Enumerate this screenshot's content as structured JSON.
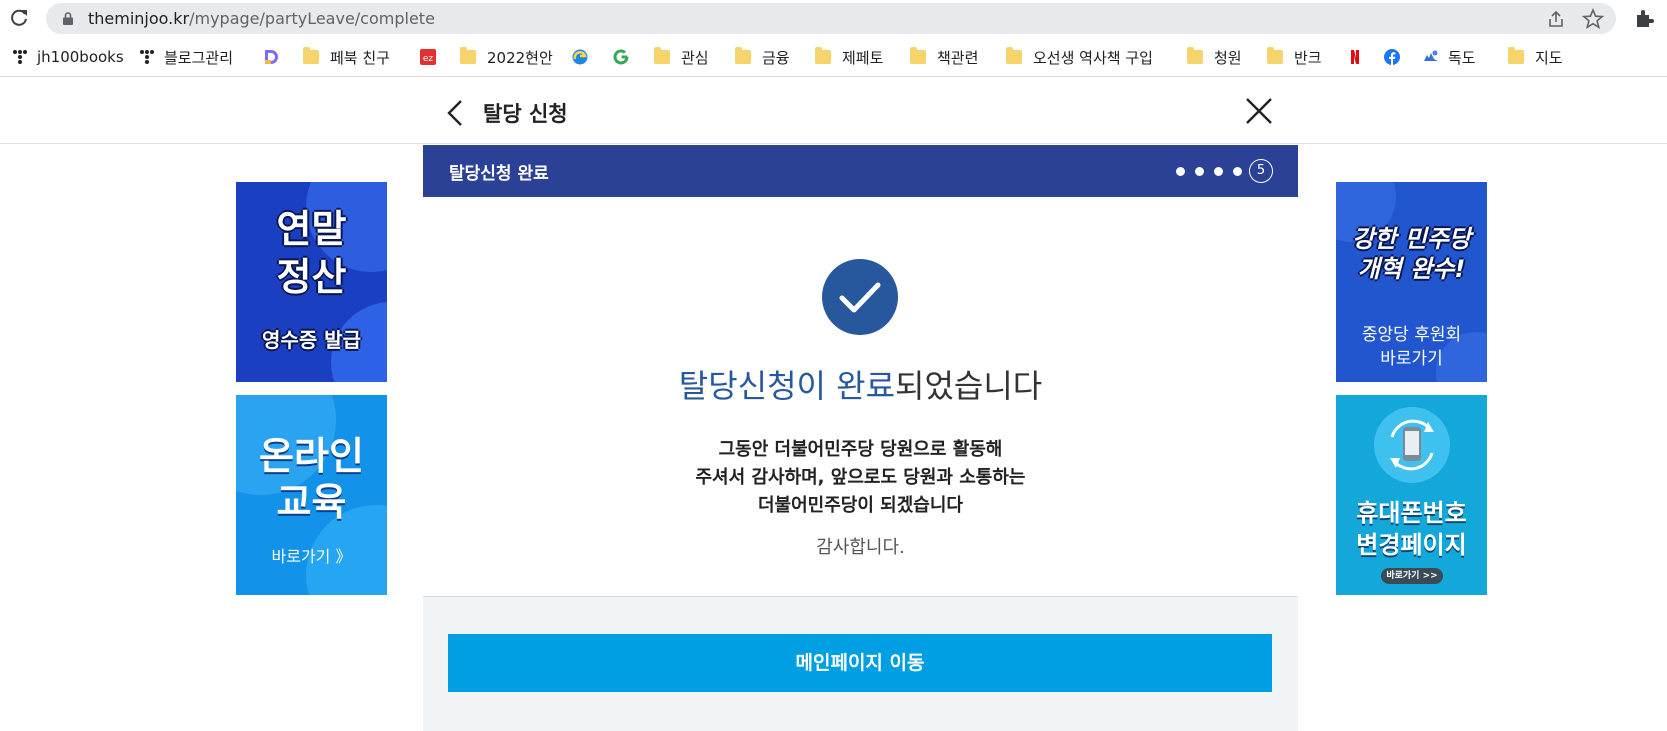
{
  "browser": {
    "url_host": "theminjoo.kr",
    "url_path": "/mypage/partyLeave/complete",
    "bookmarks": [
      {
        "label": "jh100books",
        "icon": "tistory-icon"
      },
      {
        "label": "블로그관리",
        "icon": "tistory-icon"
      },
      {
        "label": "",
        "icon": "d-logo-icon"
      },
      {
        "label": "페북 친구",
        "icon": "folder-icon"
      },
      {
        "label": "",
        "icon": "ez-icon"
      },
      {
        "label": "2022현안",
        "icon": "folder-icon"
      },
      {
        "label": "",
        "icon": "edge-icon"
      },
      {
        "label": "",
        "icon": "google-g-icon"
      },
      {
        "label": "관심",
        "icon": "folder-icon"
      },
      {
        "label": "금융",
        "icon": "folder-icon"
      },
      {
        "label": "제페토",
        "icon": "folder-icon"
      },
      {
        "label": "책관련",
        "icon": "folder-icon"
      },
      {
        "label": "오선생 역사책 구입",
        "icon": "folder-icon"
      },
      {
        "label": "청원",
        "icon": "folder-icon"
      },
      {
        "label": "반크",
        "icon": "folder-icon"
      },
      {
        "label": "",
        "icon": "netflix-icon"
      },
      {
        "label": "",
        "icon": "facebook-icon"
      },
      {
        "label": "독도",
        "icon": "dokdo-icon"
      },
      {
        "label": "지도",
        "icon": "folder-icon"
      }
    ]
  },
  "header": {
    "title": "탈당 신청"
  },
  "steps": {
    "title": "탈당신청 완료",
    "current_step": "5"
  },
  "result": {
    "headline_highlight": "탈당신청이 완료",
    "headline_rest": "되었습니다",
    "message_lines": [
      "그동안 더불어민주당 당원으로 활동해",
      "주셔서 감사하며, 앞으로도 당원과 소통하는",
      "더불어민주당이 되겠습니다"
    ],
    "thanks": "감사합니다.",
    "button_label": "메인페이지 이동"
  },
  "banners": {
    "left_top": {
      "line1": "연말",
      "line2": "정산",
      "line3": "영수증 발급"
    },
    "left_bottom": {
      "line1": "온라인",
      "line2": "교육",
      "line3": "바로가기 》"
    },
    "right_top": {
      "line1": "강한 민주당",
      "line2": "개혁 완수!",
      "line3": "중앙당 후원회",
      "line4": "바로가기"
    },
    "right_bottom": {
      "line1": "휴대폰번호",
      "line2": "변경페이지",
      "line3": "바로가기 >>"
    }
  },
  "colors": {
    "steps_bar": "#2b4195",
    "accent_blue": "#27589e",
    "button": "#009ee2"
  }
}
